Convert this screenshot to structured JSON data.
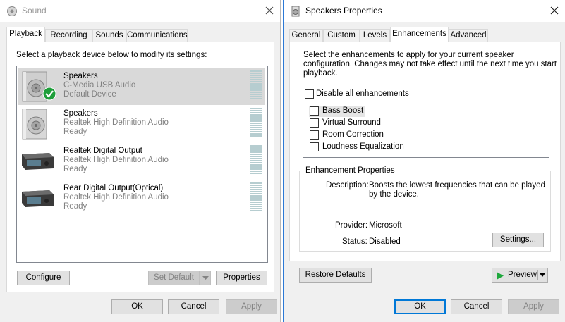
{
  "sound": {
    "title": "Sound",
    "tabs": [
      "Playback",
      "Recording",
      "Sounds",
      "Communications"
    ],
    "instruction": "Select a playback device below to modify its settings:",
    "devices": [
      {
        "name": "Speakers",
        "driver": "C-Media USB Audio",
        "status": "Default Device",
        "icon": "speaker-icon",
        "selected": true,
        "default_badge": "green-check-icon"
      },
      {
        "name": "Speakers",
        "driver": "Realtek High Definition Audio",
        "status": "Ready",
        "icon": "speaker-icon",
        "selected": false
      },
      {
        "name": "Realtek Digital Output",
        "driver": "Realtek High Definition Audio",
        "status": "Ready",
        "icon": "digital-output-icon",
        "selected": false
      },
      {
        "name": "Rear Digital Output(Optical)",
        "driver": "Realtek High Definition Audio",
        "status": "Ready",
        "icon": "digital-output-icon",
        "selected": false
      }
    ],
    "buttons": {
      "configure": "Configure",
      "set_default": "Set Default",
      "properties": "Properties",
      "ok": "OK",
      "cancel": "Cancel",
      "apply": "Apply"
    }
  },
  "speakers_props": {
    "title": "Speakers Properties",
    "tabs": [
      "General",
      "Custom",
      "Levels",
      "Enhancements",
      "Advanced"
    ],
    "active_tab": "Enhancements",
    "description_line1": "Select the enhancements to apply for your current speaker",
    "description_line2": "configuration. Changes may not take effect until the next time you start",
    "description_line3": "playback.",
    "disable_all_label": "Disable all enhancements",
    "disable_all_checked": false,
    "enhancements": [
      {
        "label": "Bass Boost",
        "checked": false,
        "highlighted": true
      },
      {
        "label": "Virtual Surround",
        "checked": false
      },
      {
        "label": "Room Correction",
        "checked": false
      },
      {
        "label": "Loudness Equalization",
        "checked": false
      }
    ],
    "properties_group": {
      "title": "Enhancement Properties",
      "description_label": "Description:",
      "description_line1": "Boosts the lowest frequencies that can be played",
      "description_line2": "by the device.",
      "provider_label": "Provider:",
      "provider_value": "Microsoft",
      "status_label": "Status:",
      "status_value": "Disabled",
      "settings_button": "Settings..."
    },
    "buttons": {
      "restore_defaults": "Restore Defaults",
      "preview": "Preview",
      "ok": "OK",
      "cancel": "Cancel",
      "apply": "Apply"
    }
  },
  "colors": {
    "accent": "#0078d7",
    "selected_row": "#d9d9d9",
    "meter": "#b6cdd0",
    "check_green": "#1e9e3a",
    "play_green": "#1ea83c"
  }
}
